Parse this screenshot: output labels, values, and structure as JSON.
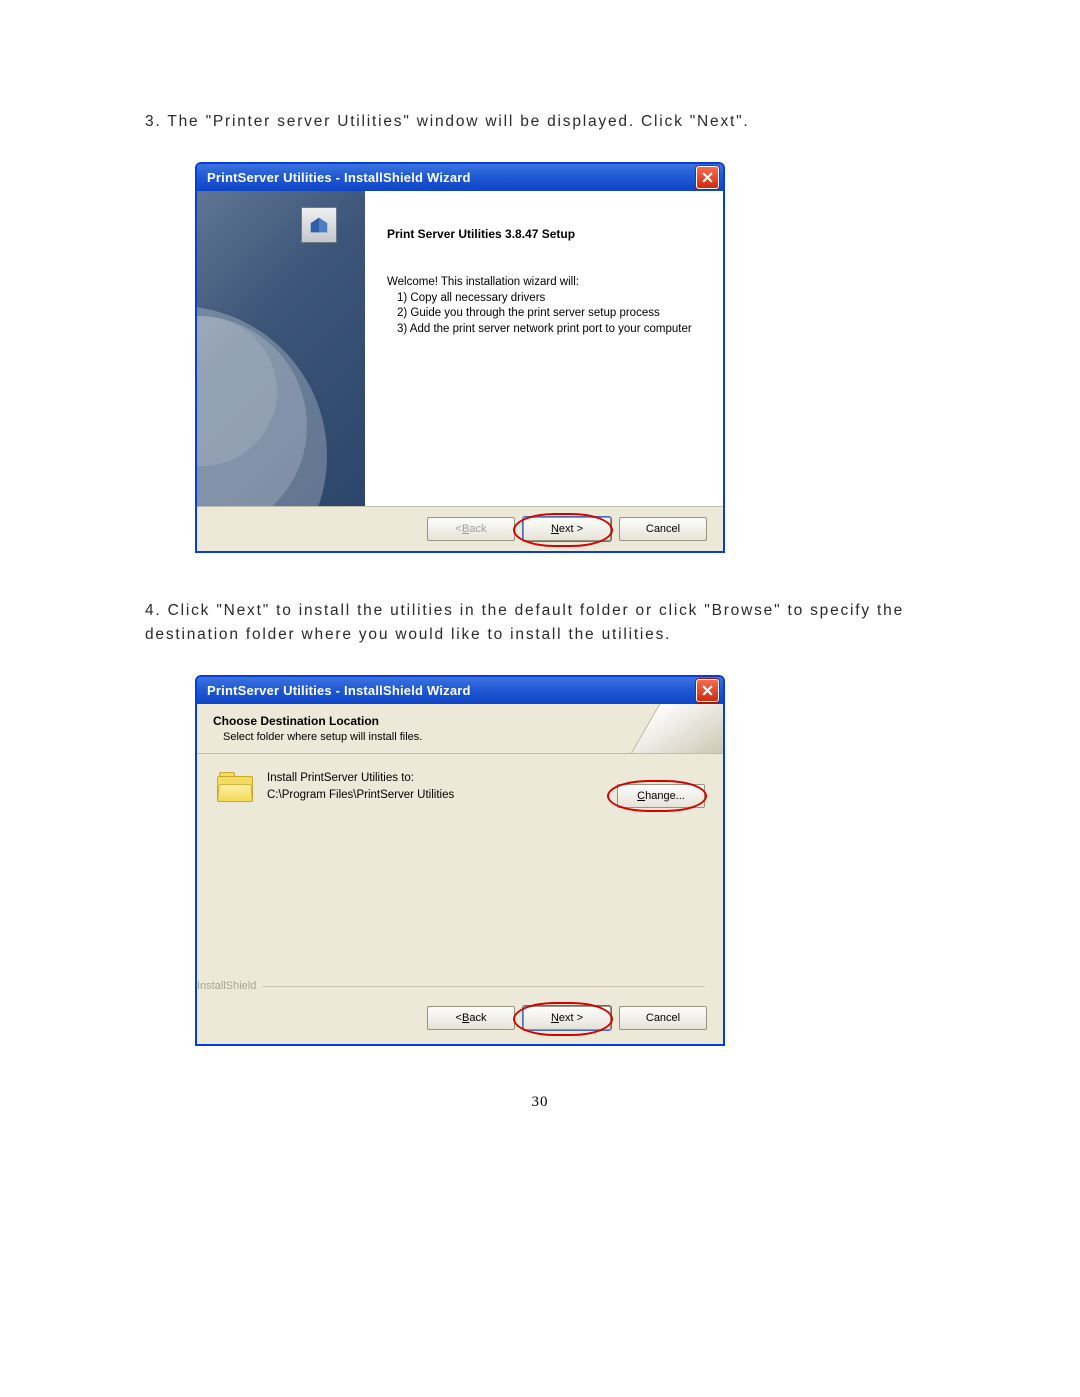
{
  "step3": {
    "text": "3.  The \"Printer server Utilities\" window will be displayed. Click \"Next\"."
  },
  "step4": {
    "text": "4.  Click \"Next\" to install the utilities in the default folder or click \"Browse\" to specify the destination folder where you would like to install the utilities."
  },
  "page_number": "30",
  "win1": {
    "title": "PrintServer Utilities - InstallShield Wizard",
    "heading": "Print Server Utilities 3.8.47 Setup",
    "welcome": "Welcome! This installation wizard will:",
    "item1": "1) Copy all necessary drivers",
    "item2": "2) Guide you through the print server setup process",
    "item3": "3) Add the print server network print port to your computer",
    "back_label_prefix": "< ",
    "back_u": "B",
    "back_suffix": "ack",
    "next_u": "N",
    "next_suffix": "ext >",
    "cancel": "Cancel"
  },
  "win2": {
    "title": "PrintServer Utilities - InstallShield Wizard",
    "header_title": "Choose Destination Location",
    "header_sub": "Select folder where setup will install files.",
    "install_to": "Install PrintServer Utilities to:",
    "path": "C:\\Program Files\\PrintServer Utilities",
    "change_u": "C",
    "change_suffix": "hange...",
    "installshield": "InstallShield",
    "back_label_prefix": "< ",
    "back_u": "B",
    "back_suffix": "ack",
    "next_u": "N",
    "next_suffix": "ext >",
    "cancel": "Cancel"
  }
}
